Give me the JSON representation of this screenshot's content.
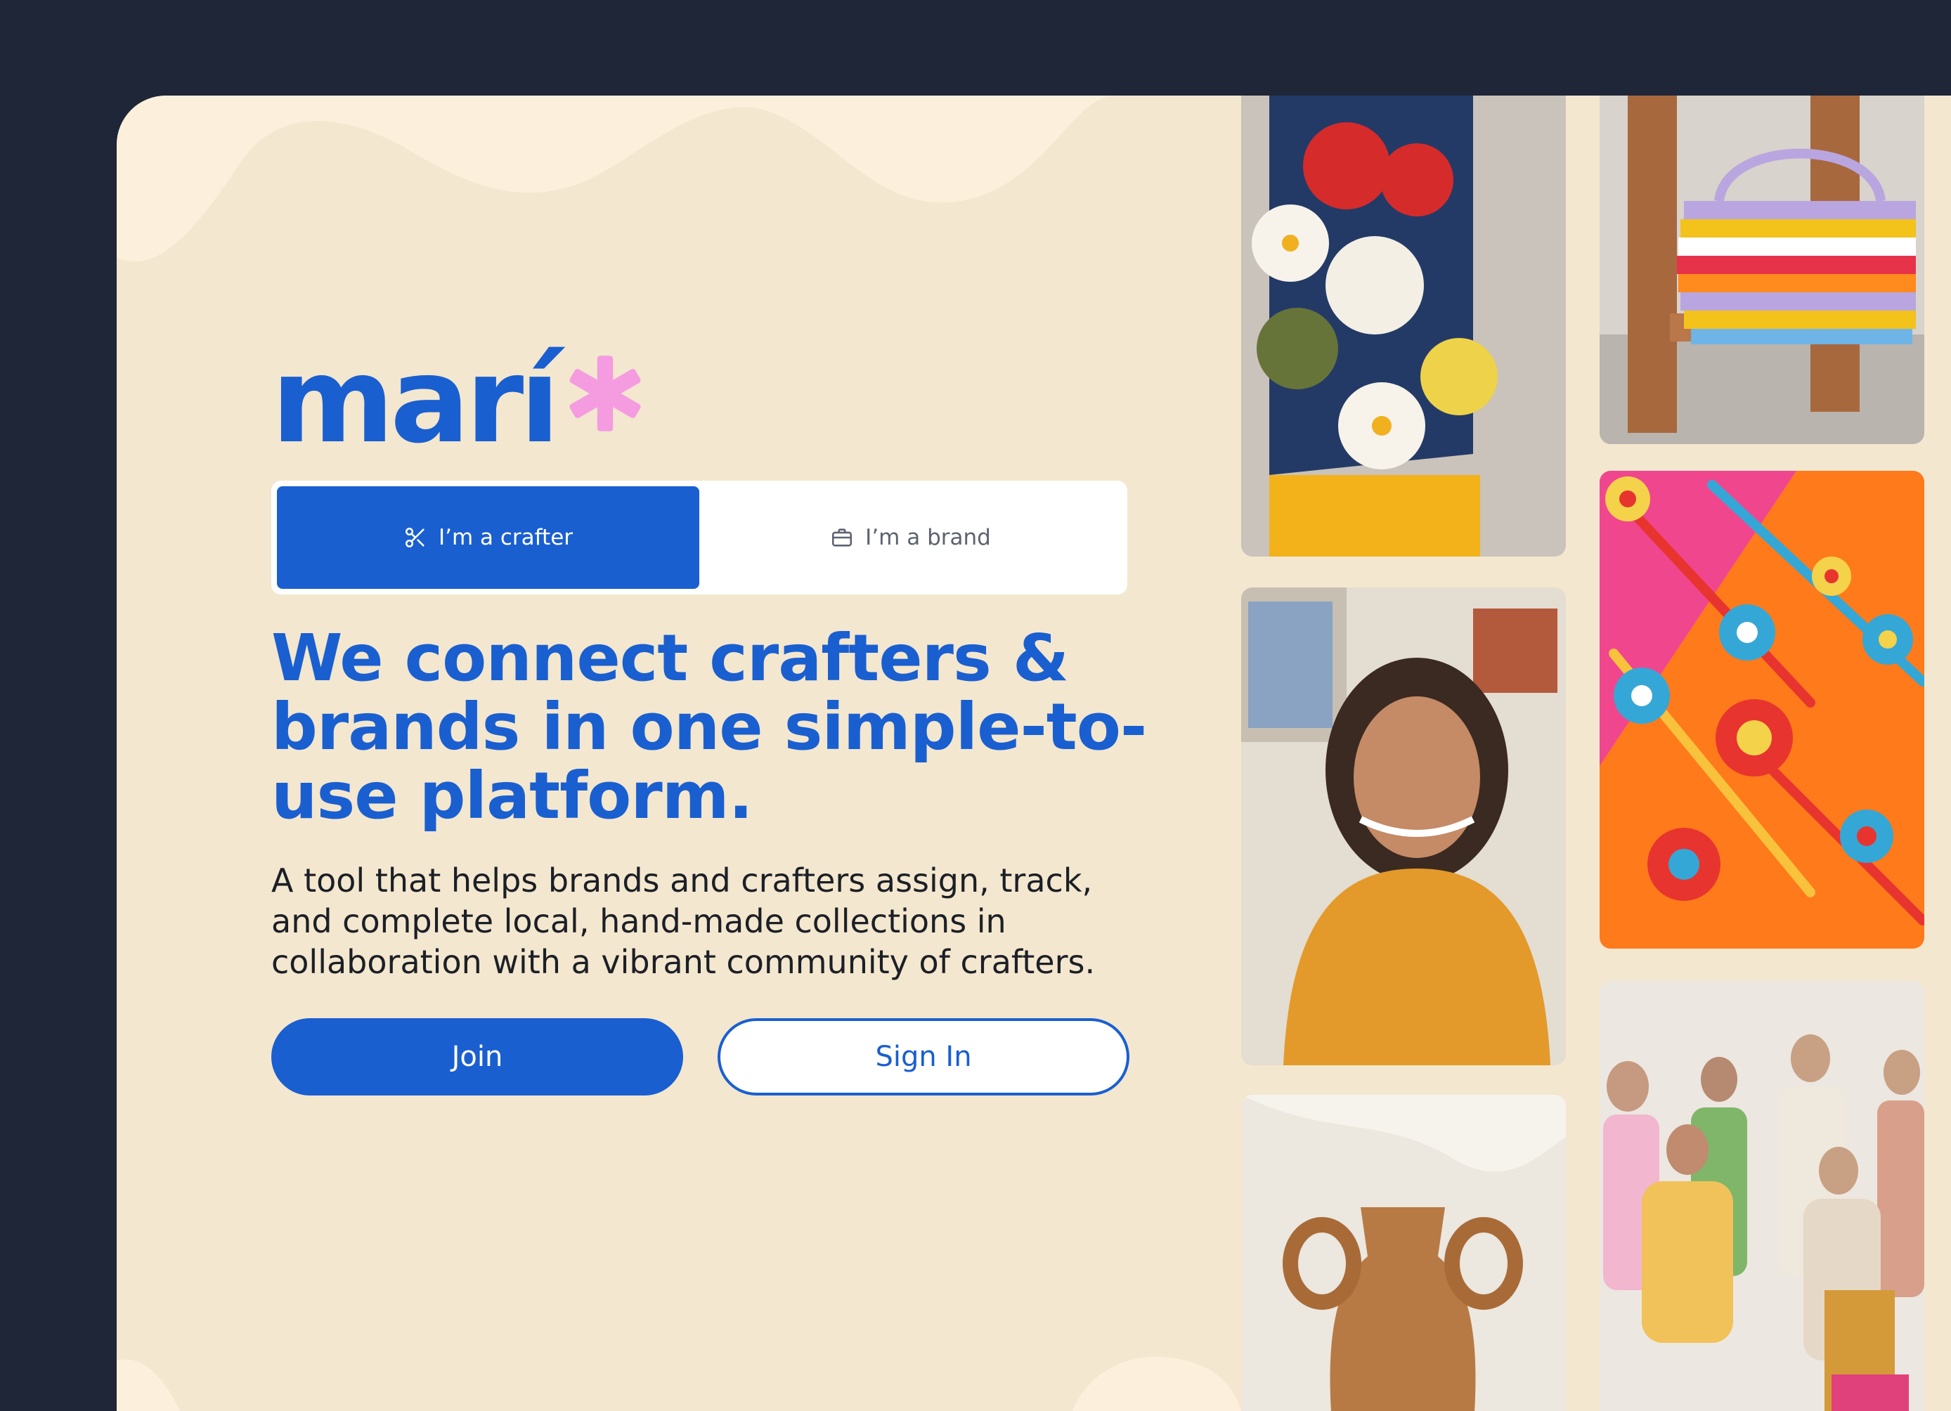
{
  "brand": {
    "logo_text": "marí",
    "primary_color": "#1a5fd0",
    "accent_color": "#f59be0",
    "background_color": "#f3e7cf",
    "outer_background": "#1e2637"
  },
  "role_switch": {
    "crafter_label": "I’m a crafter",
    "brand_label": "I’m a brand",
    "crafter_icon": "scissors-icon",
    "brand_icon": "briefcase-icon",
    "selected": "crafter"
  },
  "hero": {
    "headline": "We connect crafters & brands in one simple-to-use platform.",
    "subtext": "A tool that helps brands and crafters assign, track, and complete local, hand-made collections in collaboration with a vibrant community of crafters."
  },
  "actions": {
    "join_label": "Join",
    "signin_label": "Sign In"
  },
  "gallery": [
    {
      "id": "flower-sweater",
      "subject": "knit sweater with crochet flowers"
    },
    {
      "id": "striped-bag",
      "subject": "striped crochet bag on wooden chair"
    },
    {
      "id": "beaded-flowers",
      "subject": "beaded flower strands on orange and pink"
    },
    {
      "id": "crafter-portrait",
      "subject": "smiling crafter in orange sweater"
    },
    {
      "id": "clay-vase",
      "subject": "terracotta vase with handles"
    },
    {
      "id": "crafter-group",
      "subject": "group of crafters"
    }
  ]
}
